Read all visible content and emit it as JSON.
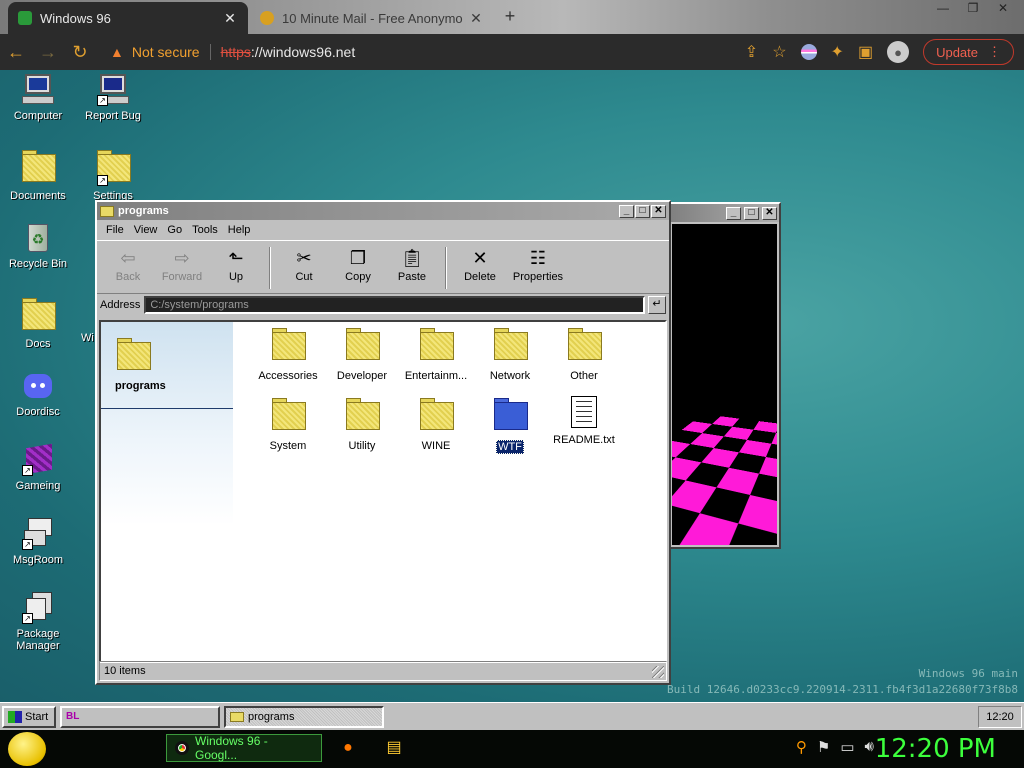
{
  "browser": {
    "tabs": [
      {
        "title": "Windows 96",
        "active": true
      },
      {
        "title": "10 Minute Mail - Free Anonymo",
        "active": false
      }
    ],
    "new_tab": "+",
    "security_label": "Not secure",
    "url_protocol": "https",
    "url_rest": "://windows96.net",
    "update_label": "Update"
  },
  "desktop": {
    "icons": [
      {
        "label": "Computer"
      },
      {
        "label": "Report Bug"
      },
      {
        "label": "Documents"
      },
      {
        "label": "Settings"
      },
      {
        "label": "Recycle Bin"
      },
      {
        "label": "Docs"
      },
      {
        "label": "Wi"
      },
      {
        "label": "Doordisc"
      },
      {
        "label": "Gameing"
      },
      {
        "label": "MsgRoom"
      },
      {
        "label": "Package Manager"
      }
    ],
    "watermark_line1": "Windows 96 main",
    "watermark_line2": "Build 12646.d0233cc9.220914-2311.fb4f3d1a22680f73f8b8"
  },
  "explorer": {
    "title": "programs",
    "menu": [
      "File",
      "View",
      "Go",
      "Tools",
      "Help"
    ],
    "toolbar": [
      {
        "label": "Back",
        "icon": "back-arrow-icon",
        "disabled": true
      },
      {
        "label": "Forward",
        "icon": "forward-arrow-icon",
        "disabled": true
      },
      {
        "label": "Up",
        "icon": "up-folder-icon",
        "disabled": false
      },
      {
        "label": "Cut",
        "icon": "scissors-icon",
        "disabled": false
      },
      {
        "label": "Copy",
        "icon": "copy-icon",
        "disabled": false
      },
      {
        "label": "Paste",
        "icon": "paste-icon",
        "disabled": false
      },
      {
        "label": "Delete",
        "icon": "delete-x-icon",
        "disabled": false
      },
      {
        "label": "Properties",
        "icon": "properties-icon",
        "disabled": false
      }
    ],
    "address_label": "Address",
    "address_value": "C:/system/programs",
    "sidebar_title": "programs",
    "items": [
      {
        "label": "Accessories",
        "type": "folder"
      },
      {
        "label": "Developer",
        "type": "folder"
      },
      {
        "label": "Entertainm...",
        "type": "folder"
      },
      {
        "label": "Network",
        "type": "folder"
      },
      {
        "label": "Other",
        "type": "folder"
      },
      {
        "label": "System",
        "type": "folder"
      },
      {
        "label": "Utility",
        "type": "folder"
      },
      {
        "label": "WINE",
        "type": "folder"
      },
      {
        "label": "WTF",
        "type": "folder-blue",
        "selected": true
      },
      {
        "label": "README.txt",
        "type": "text"
      }
    ],
    "status": "10 items"
  },
  "taskbar96": {
    "start_label": "Start",
    "unnamed_task": "",
    "active_task": "programs",
    "clock": "12:20"
  },
  "hostbar": {
    "app_label": "Windows 96 - Googl...",
    "clock": "12:20 PM"
  },
  "colors": {
    "desktop_teal": "#2e8a8f",
    "host_clock_green": "#3cff3c",
    "selection_blue": "#0a246a"
  }
}
